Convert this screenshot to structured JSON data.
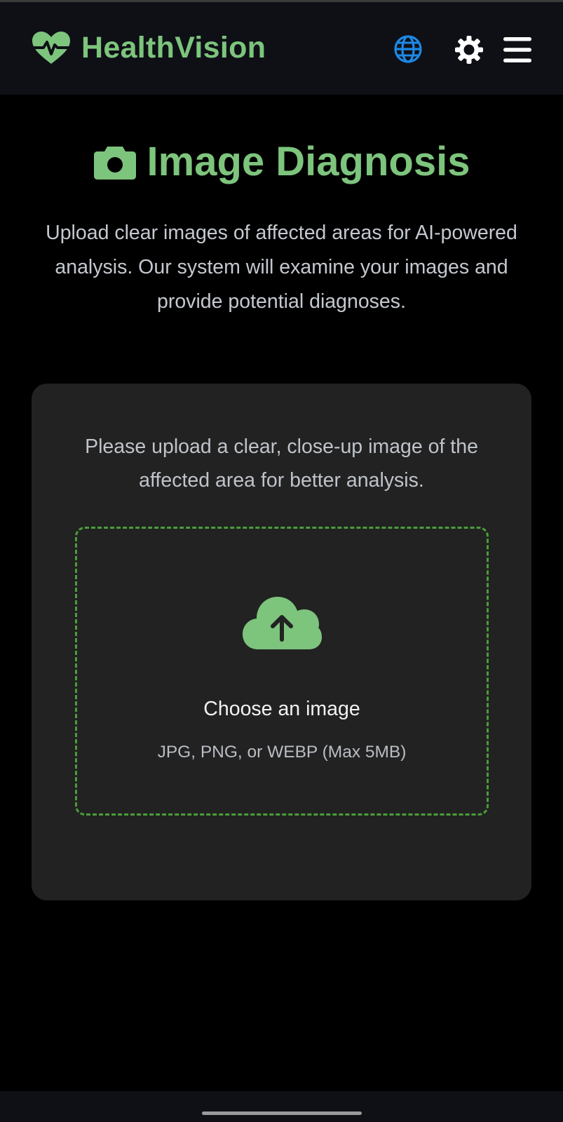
{
  "app": {
    "name": "HealthVision",
    "brand_color": "#7dc47d",
    "brand_icon": "heartbeat-icon"
  },
  "header": {
    "actions": [
      {
        "icon": "globe-icon",
        "color": "#1e88e5"
      },
      {
        "icon": "gear-icon",
        "color": "#ffffff"
      },
      {
        "icon": "hamburger-menu-icon",
        "color": "#ffffff"
      }
    ]
  },
  "page": {
    "title_icon": "camera-icon",
    "title": "Image Diagnosis",
    "intro": "Upload clear images of affected areas for AI-powered analysis. Our system will examine your images and provide potential diagnoses."
  },
  "upload": {
    "hint": "Please upload a clear, close-up image of the affected area for better analysis.",
    "icon": "cloud-upload-icon",
    "choose_label": "Choose an image",
    "formats": "JPG, PNG, or WEBP (Max 5MB)",
    "dropzone_border_color": "#4a9e3a"
  }
}
